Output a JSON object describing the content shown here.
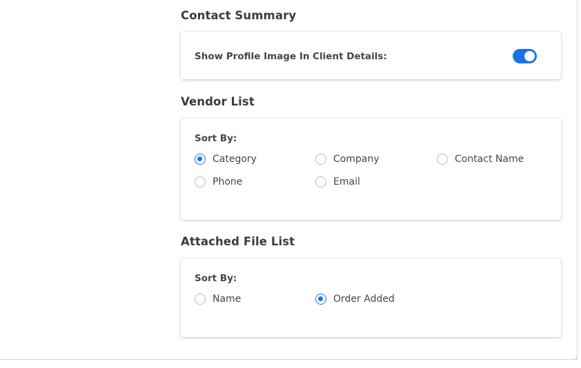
{
  "sections": {
    "contact_summary": {
      "title": "Contact Summary",
      "toggle_label": "Show Profile Image In Client Details:",
      "toggle_on": true
    },
    "vendor_list": {
      "title": "Vendor List",
      "sort_label": "Sort By:",
      "options": [
        "Category",
        "Company",
        "Contact Name",
        "Phone",
        "Email"
      ],
      "selected": "Category"
    },
    "attached_file_list": {
      "title": "Attached File List",
      "sort_label": "Sort By:",
      "options": [
        "Name",
        "Order Added"
      ],
      "selected": "Order Added"
    }
  },
  "colors": {
    "accent": "#1a73e8",
    "text": "#454545",
    "title": "#3b3b3b"
  }
}
